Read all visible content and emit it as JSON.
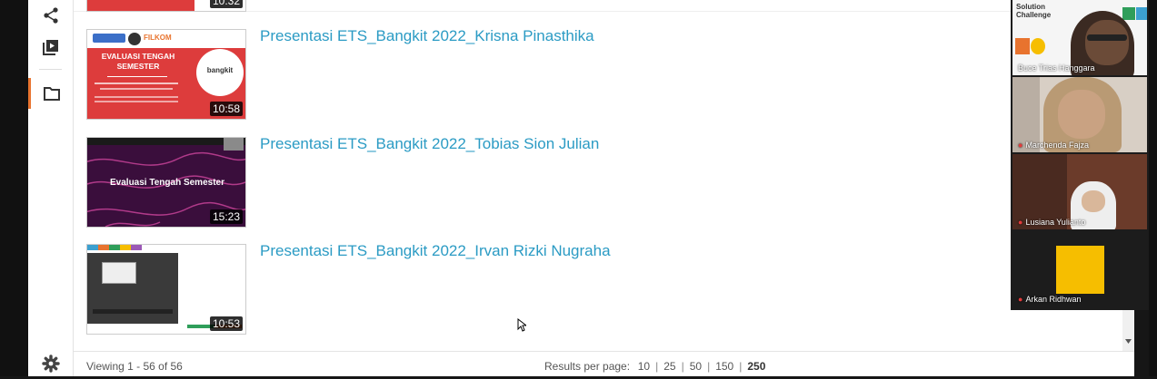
{
  "sidebar": {
    "icons": [
      "share-icon",
      "playlist-icon",
      "folder-icon",
      "gear-icon"
    ]
  },
  "videos": [
    {
      "title": "",
      "duration": "10:32"
    },
    {
      "title": "Presentasi ETS_Bangkit 2022_Krisna Pinasthika",
      "duration": "10:58",
      "thumb_title": "EVALUASI TENGAH SEMESTER",
      "thumb_logo_text": "bangkit",
      "thumb_brand": "FILKOM"
    },
    {
      "title": "Presentasi ETS_Bangkit 2022_Tobias Sion Julian",
      "duration": "15:23",
      "thumb_title": "Evaluasi Tengah Semester"
    },
    {
      "title": "Presentasi ETS_Bangkit 2022_Irvan Rizki Nugraha",
      "duration": "10:53"
    }
  ],
  "footer": {
    "viewing": "Viewing 1 - 56 of 56",
    "results_label": "Results per page:",
    "options": [
      "10",
      "25",
      "50",
      "150",
      "250"
    ],
    "selected": "250"
  },
  "participants": [
    {
      "name": "Buce Trias Hanggara",
      "bg_text_1": "Solution",
      "bg_text_2": "Challenge"
    },
    {
      "name": "Marchenda Fajza"
    },
    {
      "name": "Lusiana Yulianto"
    },
    {
      "name": "Arkan Ridhwan"
    }
  ],
  "colors": {
    "link": "#2b9bc4",
    "accent": "#e8732e",
    "red": "#dd3c3c",
    "yellow": "#f6be00"
  }
}
